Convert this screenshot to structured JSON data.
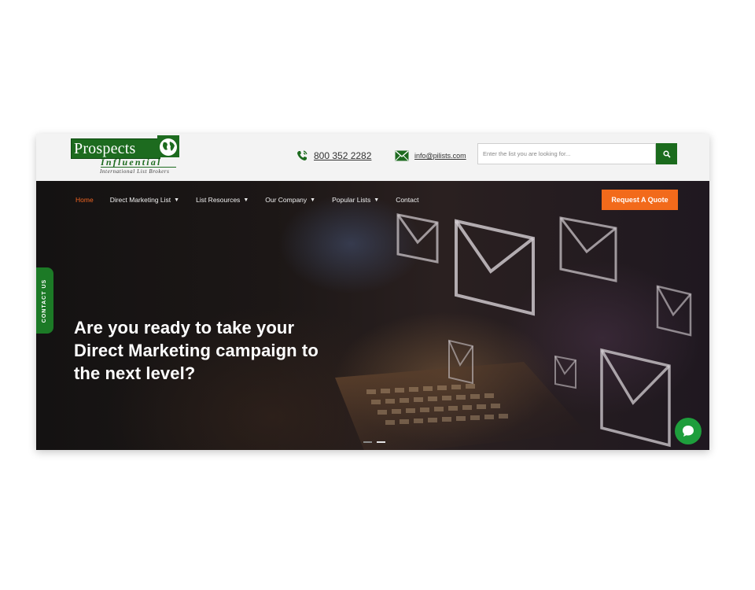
{
  "brand": {
    "name": "Prospects",
    "sub": "Influential",
    "tagline": "International List Brokers",
    "colors": {
      "green": "#1d6b1f",
      "orange": "#f26a1b",
      "chat": "#1e9e3c"
    }
  },
  "contact": {
    "phone": "800 352 2282",
    "email": "info@pilists.com"
  },
  "search": {
    "placeholder": "Enter the list you are looking for...",
    "icon": "search-icon"
  },
  "nav": {
    "items": [
      {
        "label": "Home",
        "active": true,
        "dropdown": false
      },
      {
        "label": "Direct Marketing List",
        "active": false,
        "dropdown": true
      },
      {
        "label": "List Resources",
        "active": false,
        "dropdown": true
      },
      {
        "label": "Our Company",
        "active": false,
        "dropdown": true
      },
      {
        "label": "Popular Lists",
        "active": false,
        "dropdown": true
      },
      {
        "label": "Contact",
        "active": false,
        "dropdown": false
      }
    ],
    "cta": "Request A Quote"
  },
  "side_tab": "CONTACT US",
  "hero": {
    "headline_lines": [
      "Are you ready to take your",
      "Direct Marketing campaign to",
      "the next level?"
    ]
  },
  "slider": {
    "count": 2,
    "active_index": 1
  }
}
